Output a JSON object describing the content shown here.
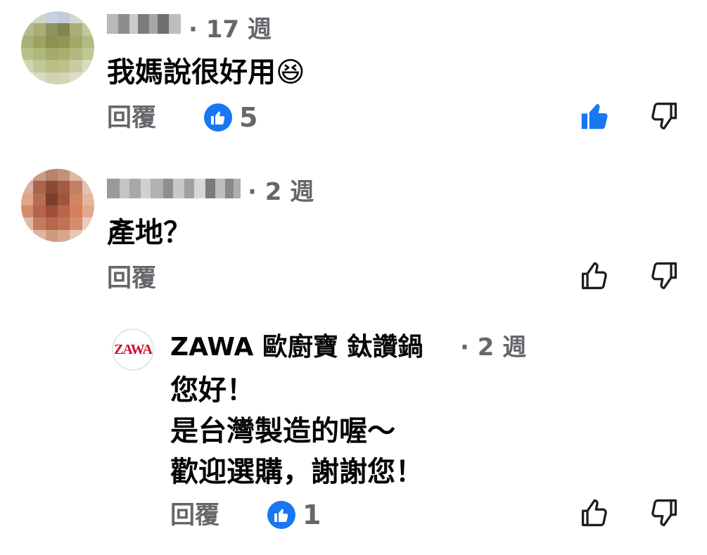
{
  "comments": [
    {
      "time": "· 17 週",
      "text": "我媽說很好用😆",
      "reply_label": "回覆",
      "like_count": "5",
      "liked": true
    },
    {
      "time": "· 2 週",
      "text": "產地？",
      "reply_label": "回覆",
      "liked": false
    }
  ],
  "reply": {
    "logo_text": "ZAWA",
    "author": "ZAWA 歐廚寶 鈦讚鍋",
    "time": "· 2 週",
    "text": "您好！\n是台灣製造的喔～\n歡迎選購，謝謝您！",
    "reply_label": "回覆",
    "like_count": "1"
  },
  "colors": {
    "accent": "#1877f2",
    "secondary_text": "#65676b",
    "primary_text": "#050505",
    "zawa_red": "#c8102e"
  },
  "icons": {
    "like": "thumbs-up-icon",
    "dislike": "thumbs-down-icon"
  }
}
